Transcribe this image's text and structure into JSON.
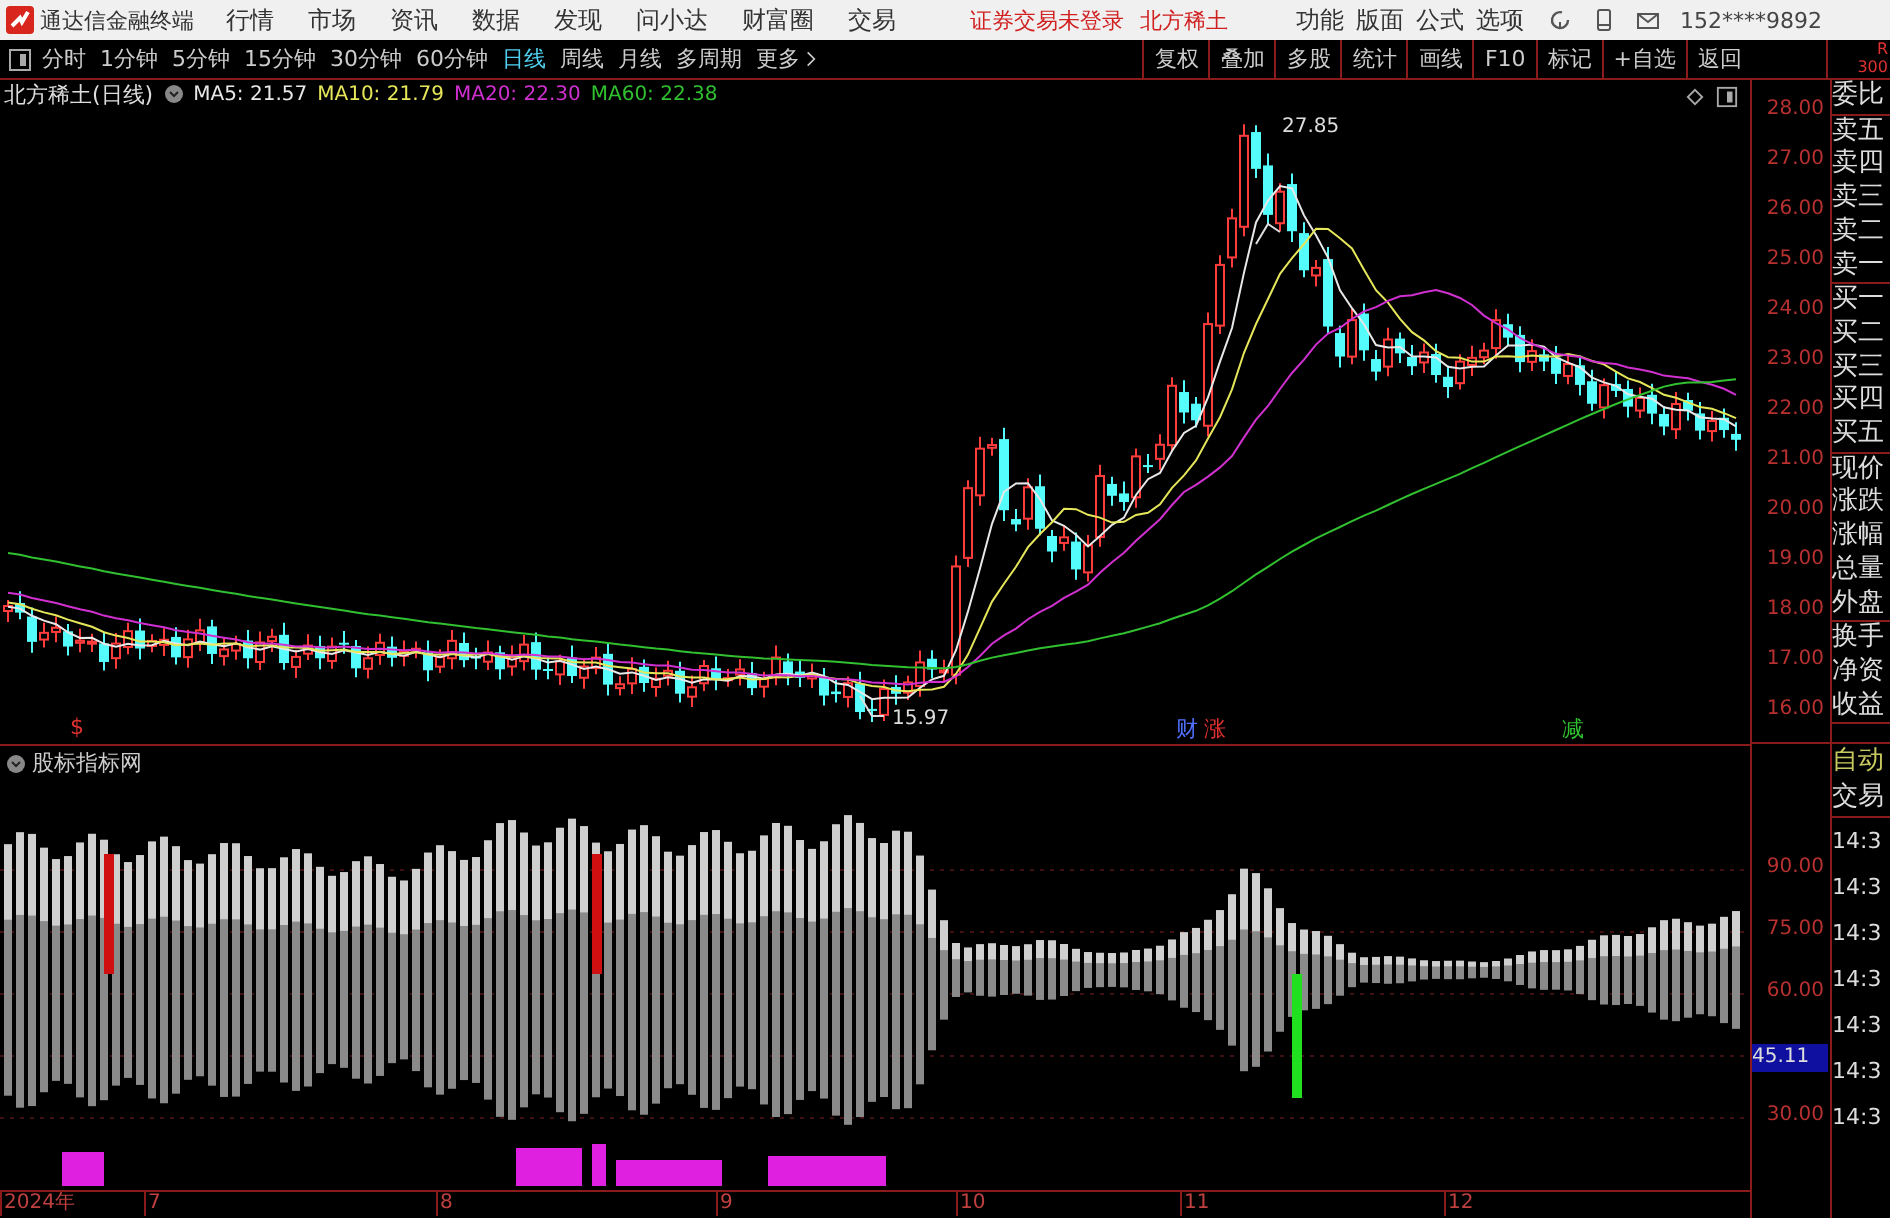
{
  "app_bar": {
    "title": "通达信金融终端",
    "menu": [
      "行情",
      "市场",
      "资讯",
      "数据",
      "发现",
      "问小达",
      "财富圈",
      "交易"
    ],
    "notice": "证券交易未登录",
    "stock": "北方稀土",
    "tools": [
      "功能",
      "版面",
      "公式",
      "选项"
    ],
    "account": "152****9892"
  },
  "toolbar": {
    "periods": [
      {
        "label": "分时",
        "selected": false
      },
      {
        "label": "1分钟",
        "selected": false
      },
      {
        "label": "5分钟",
        "selected": false
      },
      {
        "label": "15分钟",
        "selected": false
      },
      {
        "label": "30分钟",
        "selected": false
      },
      {
        "label": "60分钟",
        "selected": false
      },
      {
        "label": "日线",
        "selected": true
      },
      {
        "label": "周线",
        "selected": false
      },
      {
        "label": "月线",
        "selected": false
      },
      {
        "label": "多周期",
        "selected": false
      }
    ],
    "more": "更多",
    "actions": [
      "复权",
      "叠加",
      "多股",
      "统计",
      "画线",
      "F10",
      "标记",
      "+自选",
      "返回"
    ],
    "corner": [
      "R",
      "300"
    ]
  },
  "main_chart": {
    "title": "北方稀土(日线)",
    "ma": [
      {
        "label": "MA5: 21.57",
        "color": "#e8e8e8"
      },
      {
        "label": "MA10: 21.79",
        "color": "#e6e65a"
      },
      {
        "label": "MA20: 22.30",
        "color": "#d030d0"
      },
      {
        "label": "MA60: 22.38",
        "color": "#30c030"
      }
    ],
    "high_label": "27.85",
    "low_label": "15.97",
    "markers": [
      {
        "text": "$",
        "color": "#e03030"
      },
      {
        "text": "财",
        "color": "#5070ff"
      },
      {
        "text": "涨",
        "color": "#e03030"
      },
      {
        "text": "减",
        "color": "#30c030"
      }
    ],
    "y_ticks": [
      "28.00",
      "27.00",
      "26.00",
      "25.00",
      "24.00",
      "23.00",
      "22.00",
      "21.00",
      "20.00",
      "19.00",
      "18.00",
      "17.00",
      "16.00"
    ]
  },
  "indicator": {
    "title": "股标指标网",
    "y_ticks": [
      "90.00",
      "75.00",
      "60.00",
      "30.00"
    ],
    "current": "45.11"
  },
  "x_axis": [
    "2024年",
    "7",
    "8",
    "9",
    "10",
    "11",
    "12"
  ],
  "side_panel": {
    "quote_groups": [
      [
        "委比"
      ],
      [
        "卖五",
        "卖四",
        "卖三",
        "卖二",
        "卖一"
      ],
      [
        "买一",
        "买二",
        "买三",
        "买四",
        "买五"
      ],
      [
        "现价",
        "涨跌",
        "涨幅",
        "总量",
        "外盘"
      ],
      [
        "换手",
        "净资",
        "收益"
      ]
    ],
    "mode": "自动",
    "trade": "交易",
    "times": [
      "14:3",
      "14:3",
      "14:3",
      "14:3",
      "14:3",
      "14:3",
      "14:3"
    ]
  }
}
